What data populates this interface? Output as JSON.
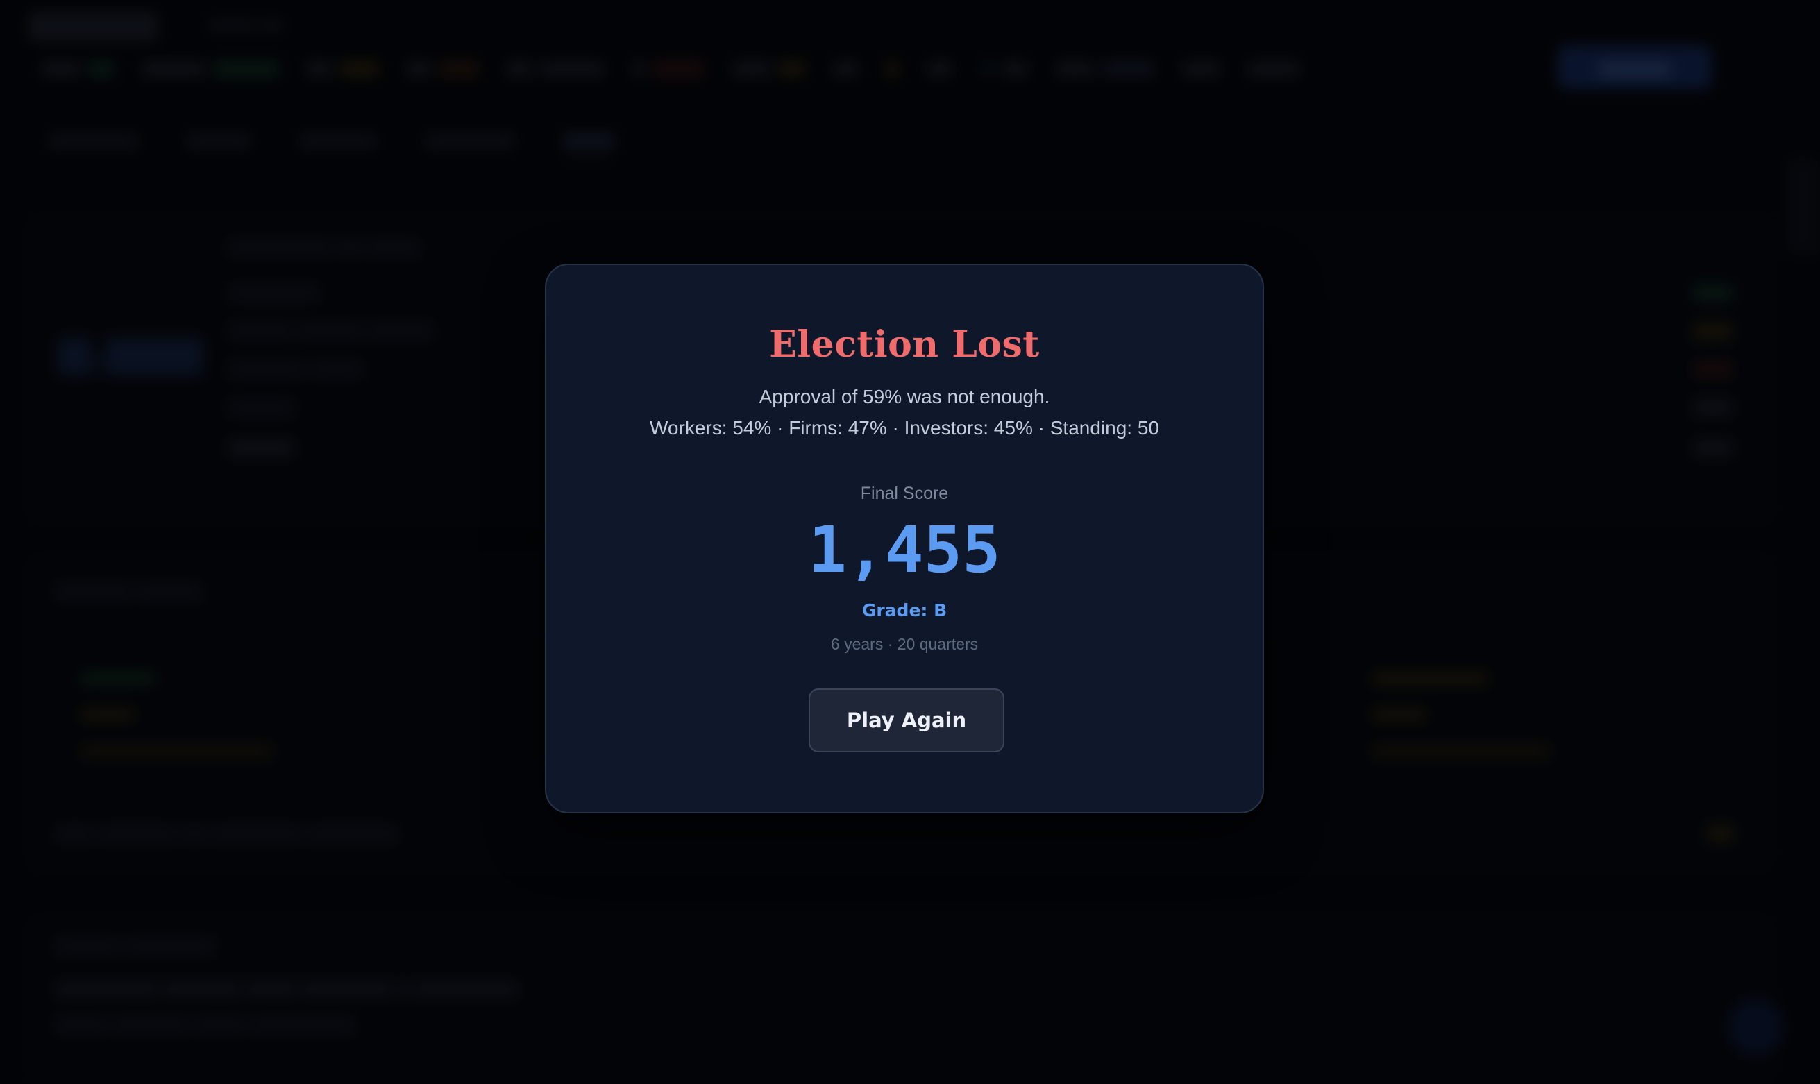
{
  "modal": {
    "title": "Election Lost",
    "approval_message": "Approval of 59% was not enough.",
    "breakdown": "Workers: 54% · Firms: 47% · Investors: 45% · Standing: 50",
    "score_label": "Final Score",
    "score": "1,455",
    "grade": "Grade: B",
    "duration": "6 years · 20 quarters",
    "play_again_label": "Play Again"
  },
  "colors": {
    "title": "#f06b6b",
    "score": "#5b9cf2",
    "modal_bg": "#0f172a",
    "button_bg": "#1f2637"
  }
}
